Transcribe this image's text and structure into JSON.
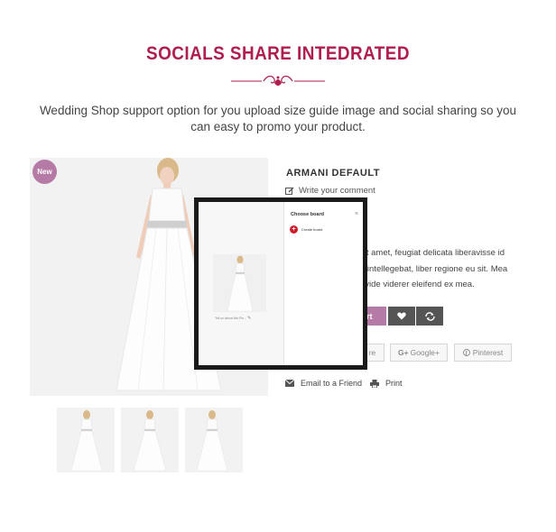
{
  "hero": {
    "title": "SOCIALS SHARE INTEDRATED",
    "description": "Wedding Shop support option for you upload size guide image and social sharing so you can easy to promo your product."
  },
  "product": {
    "badge": "New",
    "title": "ARMANI DEFAULT",
    "write_review": "Write your comment",
    "description_lines": [
      "sit amet, feugiat delicata liberavisse id",
      "n intellegebat, liber regione eu sit. Mea",
      ", vide viderer eleifend ex mea."
    ],
    "cart_label": "art",
    "share_buttons": [
      "re",
      "Google+",
      "Pinterest"
    ],
    "email_label": "Email to a Friend",
    "print_label": "Print"
  },
  "modal": {
    "heading": "Choose board",
    "close": "×",
    "create_board": "Create board",
    "caption": "Tell us about this Pin..."
  },
  "colors": {
    "brand": "#b01e4e",
    "badge": "#b57aa6",
    "dark_button": "#555555",
    "pinterest_red": "#cc1d2c"
  },
  "icons": {
    "review": "pencil-square-icon",
    "wishlist": "heart-icon",
    "compare": "refresh-icon",
    "google": "google-plus-icon",
    "pinterest": "pinterest-icon",
    "email": "envelope-icon",
    "print": "printer-icon"
  }
}
